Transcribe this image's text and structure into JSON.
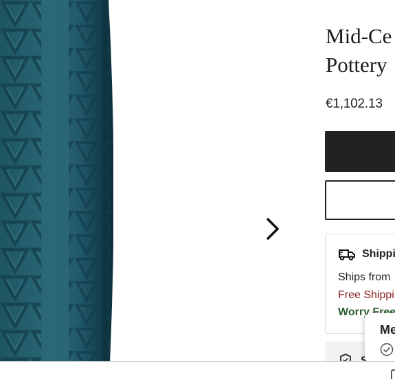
{
  "product": {
    "title": "Mid-Ce\nPottery",
    "price": "€1,102.13"
  },
  "gallery": {
    "next_icon": "chevron-right-icon",
    "vase_color": "#1f5866"
  },
  "shipping": {
    "heading": "Shippi",
    "ships_from": "Ships from",
    "free_shipping": "Free Shippi",
    "worry_free": "Worry Free",
    "icon": "truck-icon"
  },
  "protection": {
    "heading": "S",
    "icon": "shield-icon"
  },
  "toast": {
    "title": "Me",
    "icon": "check-circle-icon"
  },
  "colors": {
    "primary_button": "#222222",
    "free_shipping": "#8a1a1a",
    "worry_free": "#2d5f2e"
  }
}
